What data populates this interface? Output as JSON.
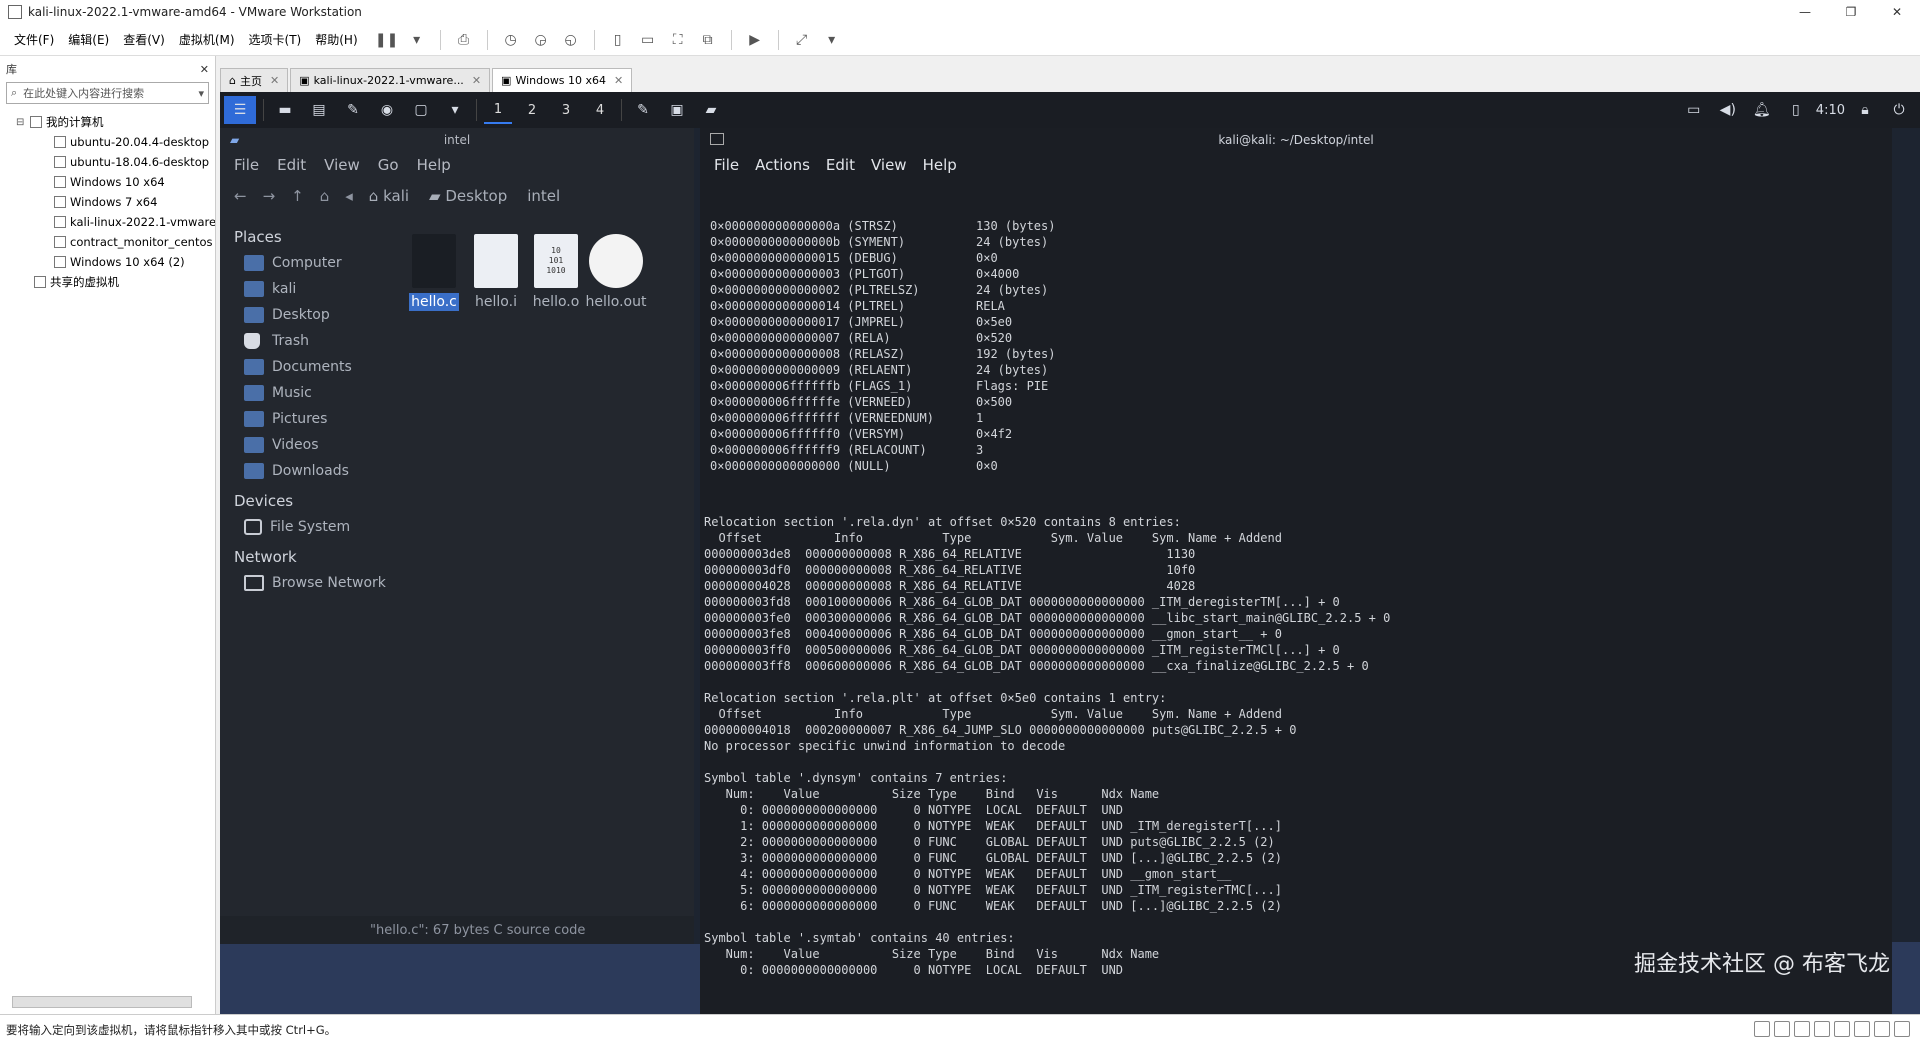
{
  "window": {
    "title": "kali-linux-2022.1-vmware-amd64 - VMware Workstation",
    "minimize": "—",
    "restore": "❐",
    "close": "✕"
  },
  "menubar": {
    "items": [
      "文件(F)",
      "编辑(E)",
      "查看(V)",
      "虚拟机(M)",
      "选项卡(T)",
      "帮助(H)"
    ]
  },
  "library": {
    "header": "库",
    "search_placeholder": "在此处键入内容进行搜索",
    "root": "我的计算机",
    "vms": [
      "ubuntu-20.04.4-desktop",
      "ubuntu-18.04.6-desktop",
      "Windows 10 x64",
      "Windows 7 x64",
      "kali-linux-2022.1-vmware",
      "contract_monitor_centos",
      "Windows 10 x64 (2)"
    ],
    "shared": "共享的虚拟机"
  },
  "tabs": [
    {
      "label": "主页"
    },
    {
      "label": "kali-linux-2022.1-vmware..."
    },
    {
      "label": "Windows 10 x64"
    }
  ],
  "kali_panel": {
    "workspaces": [
      "1",
      "2",
      "3",
      "4"
    ],
    "clock": "4:10"
  },
  "file_manager": {
    "title": "intel",
    "menu": [
      "File",
      "Edit",
      "View",
      "Go",
      "Help"
    ],
    "path": [
      "kali",
      "Desktop",
      "intel"
    ],
    "places_header": "Places",
    "places": [
      "Computer",
      "kali",
      "Desktop",
      "Trash",
      "Documents",
      "Music",
      "Pictures",
      "Videos",
      "Downloads"
    ],
    "devices_header": "Devices",
    "devices": [
      "File System"
    ],
    "network_header": "Network",
    "network": [
      "Browse Network"
    ],
    "files": [
      "hello.c",
      "hello.i",
      "hello.o",
      "hello.out"
    ],
    "binary_icon_text": "10\n101\n1010",
    "status": "\"hello.c\": 67 bytes C source code"
  },
  "terminal": {
    "title": "kali@kali: ~/Desktop/intel",
    "menu": [
      "File",
      "Actions",
      "Edit",
      "View",
      "Help"
    ],
    "dynamic_left": "0×000000000000000a (STRSZ)\n0×000000000000000b (SYMENT)\n0×0000000000000015 (DEBUG)\n0×0000000000000003 (PLTGOT)\n0×0000000000000002 (PLTRELSZ)\n0×0000000000000014 (PLTREL)\n0×0000000000000017 (JMPREL)\n0×0000000000000007 (RELA)\n0×0000000000000008 (RELASZ)\n0×0000000000000009 (RELAENT)\n0×000000006ffffffb (FLAGS_1)\n0×000000006ffffffe (VERNEED)\n0×000000006fffffff (VERNEEDNUM)\n0×000000006ffffff0 (VERSYM)\n0×000000006ffffff9 (RELACOUNT)\n0×0000000000000000 (NULL)",
    "dynamic_right": "130 (bytes)\n24 (bytes)\n0×0\n0×4000\n24 (bytes)\nRELA\n0×5e0\n0×520\n192 (bytes)\n24 (bytes)\nFlags: PIE\n0×500\n1\n0×4f2\n3\n0×0",
    "rest": "Relocation section '.rela.dyn' at offset 0×520 contains 8 entries:\n  Offset          Info           Type           Sym. Value    Sym. Name + Addend\n000000003de8  000000000008 R_X86_64_RELATIVE                    1130\n000000003df0  000000000008 R_X86_64_RELATIVE                    10f0\n000000004028  000000000008 R_X86_64_RELATIVE                    4028\n000000003fd8  000100000006 R_X86_64_GLOB_DAT 0000000000000000 _ITM_deregisterTM[...] + 0\n000000003fe0  000300000006 R_X86_64_GLOB_DAT 0000000000000000 __libc_start_main@GLIBC_2.2.5 + 0\n000000003fe8  000400000006 R_X86_64_GLOB_DAT 0000000000000000 __gmon_start__ + 0\n000000003ff0  000500000006 R_X86_64_GLOB_DAT 0000000000000000 _ITM_registerTMCl[...] + 0\n000000003ff8  000600000006 R_X86_64_GLOB_DAT 0000000000000000 __cxa_finalize@GLIBC_2.2.5 + 0\n\nRelocation section '.rela.plt' at offset 0×5e0 contains 1 entry:\n  Offset          Info           Type           Sym. Value    Sym. Name + Addend\n000000004018  000200000007 R_X86_64_JUMP_SLO 0000000000000000 puts@GLIBC_2.2.5 + 0\nNo processor specific unwind information to decode\n\nSymbol table '.dynsym' contains 7 entries:\n   Num:    Value          Size Type    Bind   Vis      Ndx Name\n     0: 0000000000000000     0 NOTYPE  LOCAL  DEFAULT  UND\n     1: 0000000000000000     0 NOTYPE  WEAK   DEFAULT  UND _ITM_deregisterT[...]\n     2: 0000000000000000     0 FUNC    GLOBAL DEFAULT  UND puts@GLIBC_2.2.5 (2)\n     3: 0000000000000000     0 FUNC    GLOBAL DEFAULT  UND [...]@GLIBC_2.2.5 (2)\n     4: 0000000000000000     0 NOTYPE  WEAK   DEFAULT  UND __gmon_start__\n     5: 0000000000000000     0 NOTYPE  WEAK   DEFAULT  UND _ITM_registerTMC[...]\n     6: 0000000000000000     0 FUNC    WEAK   DEFAULT  UND [...]@GLIBC_2.2.5 (2)\n\nSymbol table '.symtab' contains 40 entries:\n   Num:    Value          Size Type    Bind   Vis      Ndx Name\n     0: 0000000000000000     0 NOTYPE  LOCAL  DEFAULT  UND"
  },
  "watermark": "掘金技术社区 @ 布客飞龙",
  "statusbar": {
    "text": "要将输入定向到该虚拟机，请将鼠标指针移入其中或按 Ctrl+G。"
  }
}
